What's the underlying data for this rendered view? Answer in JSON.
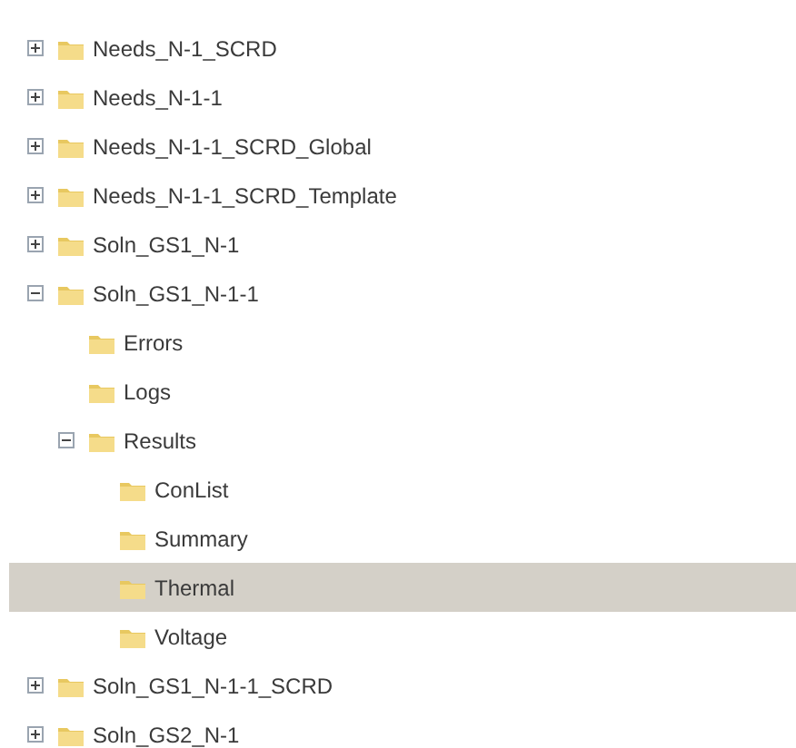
{
  "tree": [
    {
      "label": "Needs_N-1_SCRD",
      "kind": "branch",
      "expanded": false,
      "selected": false
    },
    {
      "label": "Needs_N-1-1",
      "kind": "branch",
      "expanded": false,
      "selected": false
    },
    {
      "label": "Needs_N-1-1_SCRD_Global",
      "kind": "branch",
      "expanded": false,
      "selected": false
    },
    {
      "label": "Needs_N-1-1_SCRD_Template",
      "kind": "branch",
      "expanded": false,
      "selected": false
    },
    {
      "label": "Soln_GS1_N-1",
      "kind": "branch",
      "expanded": false,
      "selected": false
    },
    {
      "label": "Soln_GS1_N-1-1",
      "kind": "branch",
      "expanded": true,
      "selected": false,
      "children": [
        {
          "label": "Errors",
          "kind": "leaf",
          "selected": false
        },
        {
          "label": "Logs",
          "kind": "leaf",
          "selected": false
        },
        {
          "label": "Results",
          "kind": "branch",
          "expanded": true,
          "selected": false,
          "children": [
            {
              "label": "ConList",
              "kind": "leaf",
              "selected": false
            },
            {
              "label": "Summary",
              "kind": "leaf",
              "selected": false
            },
            {
              "label": "Thermal",
              "kind": "leaf",
              "selected": true
            },
            {
              "label": "Voltage",
              "kind": "leaf",
              "selected": false
            }
          ]
        }
      ]
    },
    {
      "label": "Soln_GS1_N-1-1_SCRD",
      "kind": "branch",
      "expanded": false,
      "selected": false
    },
    {
      "label": "Soln_GS2_N-1",
      "kind": "branch",
      "expanded": false,
      "selected": false
    }
  ]
}
